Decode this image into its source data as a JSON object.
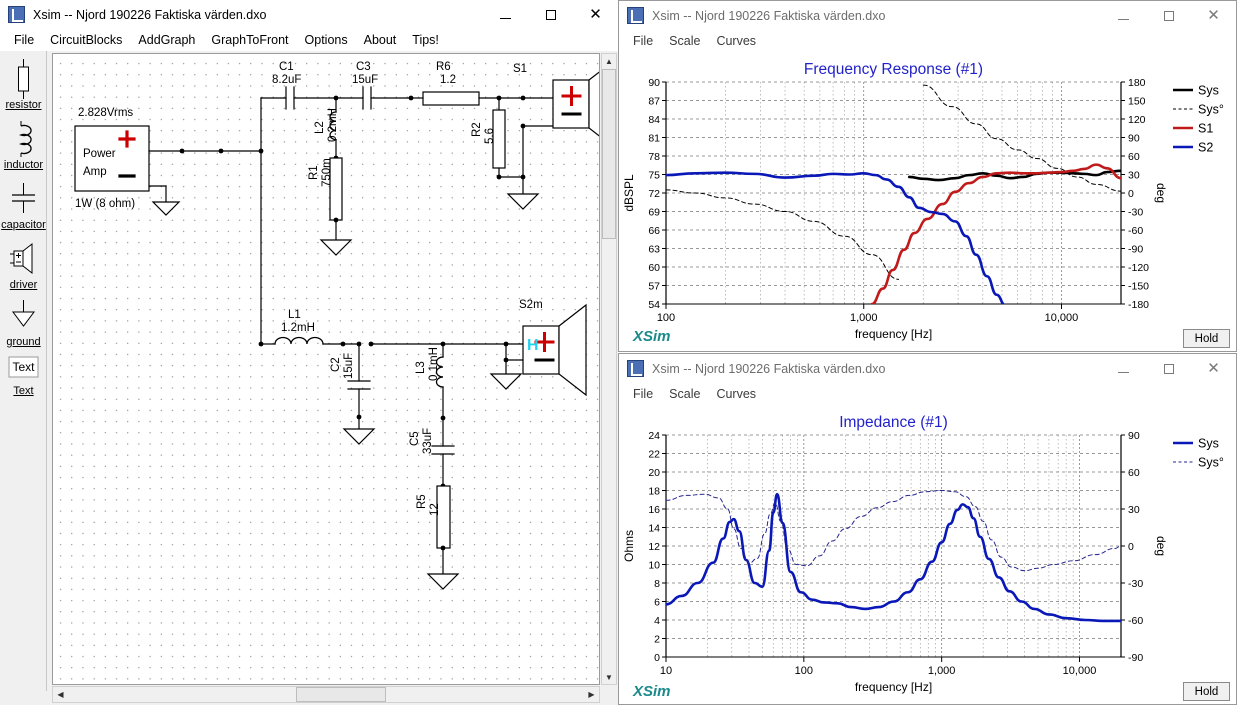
{
  "main_window": {
    "title": "Xsim -- Njord 190226 Faktiska värden.dxo",
    "icon": "xsim-app-icon",
    "controls": {
      "minimize": "—",
      "maximize": "☐",
      "close": "✕"
    },
    "menu": [
      "File",
      "CircuitBlocks",
      "AddGraph",
      "GraphToFront",
      "Options",
      "About",
      "Tips!"
    ],
    "palette": [
      {
        "label": "resistor",
        "icon": "resistor-icon"
      },
      {
        "label": "inductor",
        "icon": "inductor-icon"
      },
      {
        "label": "capacitor",
        "icon": "capacitor-icon"
      },
      {
        "label": "driver",
        "icon": "driver-icon"
      },
      {
        "label": "ground",
        "icon": "ground-icon"
      },
      {
        "label": "Text",
        "icon": "text-box-icon"
      },
      {
        "label": "Text",
        "icon": "text-label-icon"
      }
    ],
    "schematic": {
      "source": {
        "voltage": "2.828Vrms",
        "line1": "Power",
        "line2": "Amp",
        "power": "1W (8 ohm)"
      },
      "components": [
        {
          "ref": "C1",
          "value": "8.2uF"
        },
        {
          "ref": "C3",
          "value": "15uF"
        },
        {
          "ref": "R6",
          "value": "1.2"
        },
        {
          "ref": "L2",
          "value": "0.2mH"
        },
        {
          "ref": "R1",
          "value": "750m"
        },
        {
          "ref": "R2",
          "value": "5.6"
        },
        {
          "ref": "L1",
          "value": "1.2mH"
        },
        {
          "ref": "C2",
          "value": "15uF"
        },
        {
          "ref": "L3",
          "value": "0.1mH"
        },
        {
          "ref": "C5",
          "value": "33uF"
        },
        {
          "ref": "R5",
          "value": "12"
        }
      ],
      "drivers": [
        {
          "ref": "S1"
        },
        {
          "ref": "S2m",
          "marker": "H"
        }
      ]
    }
  },
  "freq_window": {
    "title": "Xsim -- Njord 190226 Faktiska värden.dxo",
    "controls": {
      "minimize": "—",
      "maximize": "☐",
      "close": "✕"
    },
    "menu": [
      "File",
      "Scale",
      "Curves"
    ],
    "hold_label": "Hold",
    "watermark": "XSim"
  },
  "imp_window": {
    "title": "Xsim -- Njord 190226 Faktiska värden.dxo",
    "controls": {
      "minimize": "—",
      "maximize": "☐",
      "close": "✕"
    },
    "menu": [
      "File",
      "Scale",
      "Curves"
    ],
    "hold_label": "Hold",
    "watermark": "XSim"
  },
  "chart_data": [
    {
      "type": "line",
      "id": "frequency-response",
      "title": "Frequency Response (#1)",
      "xlabel": "frequency [Hz]",
      "ylabel": "dBSPL",
      "y2label": "deg",
      "xscale": "log",
      "xlim": [
        100,
        20000
      ],
      "xticks": [
        100,
        1000,
        10000
      ],
      "xticklabels": [
        "100",
        "1,000",
        "10,000"
      ],
      "ylim": [
        54,
        90
      ],
      "yticks": [
        54,
        57,
        60,
        63,
        66,
        69,
        72,
        75,
        78,
        81,
        84,
        87,
        90
      ],
      "y2lim": [
        -180,
        180
      ],
      "y2ticks": [
        -180,
        -150,
        -120,
        -90,
        -60,
        -30,
        0,
        30,
        60,
        90,
        120,
        150,
        180
      ],
      "grid": true,
      "legend_position": "right",
      "legend": [
        {
          "name": "Sys",
          "color": "#000000",
          "style": "solid"
        },
        {
          "name": "Sys°",
          "color": "#000000",
          "style": "dashed"
        },
        {
          "name": "S1",
          "color": "#c01a1a",
          "style": "solid"
        },
        {
          "name": "S2",
          "color": "#0a18b8",
          "style": "solid"
        }
      ],
      "series": [
        {
          "name": "Sys",
          "color": "#000000",
          "axis": "left",
          "x": [
            1700,
            2000,
            2400,
            2900,
            3400,
            4000,
            4700,
            5500,
            6400,
            7500,
            8600,
            10000,
            11500,
            13000,
            15000,
            17000,
            20000
          ],
          "values": [
            74.6,
            74.3,
            74.1,
            74.4,
            74.9,
            75.2,
            74.8,
            74.4,
            74.6,
            75.1,
            75.3,
            75.3,
            75.2,
            75.1,
            74.9,
            75.4,
            75.6
          ]
        },
        {
          "name": "Sys°",
          "color": "#000000",
          "axis": "right",
          "style": "dashed",
          "x": [
            100,
            140,
            200,
            280,
            400,
            560,
            800,
            1100,
            1500,
            2000,
            2800,
            3700,
            4700,
            6000,
            7500,
            9500,
            12000,
            15000,
            20000
          ],
          "values": [
            5,
            0,
            -8,
            -18,
            -30,
            -46,
            -70,
            -100,
            -140,
            175,
            140,
            112,
            88,
            70,
            56,
            40,
            26,
            14,
            3
          ]
        },
        {
          "name": "S1",
          "color": "#c01a1a",
          "axis": "left",
          "x": [
            1100,
            1250,
            1400,
            1600,
            1800,
            2100,
            2500,
            2900,
            3400,
            4000,
            4700,
            5500,
            6400,
            7500,
            8600,
            10000,
            11500,
            13000,
            15000,
            17000,
            20000
          ],
          "values": [
            54.0,
            56.5,
            59.5,
            62.8,
            65.5,
            67.8,
            70.2,
            72.2,
            73.6,
            74.6,
            75.2,
            75.3,
            75.2,
            75.2,
            75.3,
            75.4,
            75.6,
            75.9,
            76.6,
            76.0,
            74.4
          ]
        },
        {
          "name": "S2",
          "color": "#0a18b8",
          "axis": "left",
          "x": [
            100,
            140,
            200,
            280,
            400,
            560,
            700,
            850,
            1000,
            1150,
            1300,
            1500,
            1700,
            1900,
            2200,
            2500,
            2900,
            3300,
            3700,
            4200,
            4700,
            5200
          ],
          "values": [
            74.9,
            75.2,
            75.3,
            75.1,
            74.5,
            74.8,
            75.1,
            75.0,
            75.2,
            74.9,
            74.2,
            73.0,
            71.3,
            69.6,
            68.9,
            68.6,
            67.4,
            65.0,
            62.0,
            58.5,
            55.5,
            53.8
          ]
        }
      ]
    },
    {
      "type": "line",
      "id": "impedance",
      "title": "Impedance (#1)",
      "xlabel": "frequency [Hz]",
      "ylabel": "Ohms",
      "y2label": "deg",
      "xscale": "log",
      "xlim": [
        10,
        20000
      ],
      "xticks": [
        10,
        100,
        1000,
        10000
      ],
      "xticklabels": [
        "10",
        "100",
        "1,000",
        "10,000"
      ],
      "ylim": [
        0,
        24
      ],
      "yticks": [
        0,
        2,
        4,
        6,
        8,
        10,
        12,
        14,
        16,
        18,
        20,
        22,
        24
      ],
      "y2lim": [
        -90,
        90
      ],
      "y2ticks": [
        -90,
        -60,
        -30,
        0,
        30,
        60,
        90
      ],
      "grid": true,
      "legend_position": "right",
      "legend": [
        {
          "name": "Sys",
          "color": "#0a18b8",
          "style": "solid"
        },
        {
          "name": "Sys°",
          "color": "#26268f",
          "style": "dashed"
        }
      ],
      "series": [
        {
          "name": "Sys",
          "color": "#0a18b8",
          "axis": "left",
          "x": [
            10,
            13,
            17,
            22,
            26,
            29,
            31,
            34,
            38,
            44,
            50,
            56,
            60,
            64,
            70,
            80,
            95,
            115,
            140,
            175,
            220,
            280,
            350,
            450,
            570,
            700,
            850,
            1000,
            1150,
            1300,
            1420,
            1550,
            1700,
            1900,
            2200,
            2600,
            3100,
            3800,
            4700,
            6000,
            8000,
            11000,
            15000,
            20000
          ],
          "values": [
            5.7,
            6.6,
            8.0,
            10.2,
            12.8,
            14.6,
            14.9,
            13.6,
            10.5,
            8.0,
            7.6,
            11.5,
            15.6,
            17.6,
            14.5,
            9.2,
            7.0,
            6.2,
            5.9,
            5.8,
            5.4,
            5.2,
            5.4,
            6.0,
            7.0,
            8.4,
            10.3,
            12.4,
            14.4,
            15.9,
            16.5,
            16.2,
            15.0,
            13.0,
            10.6,
            8.6,
            7.1,
            6.0,
            5.2,
            4.6,
            4.2,
            4.0,
            3.9,
            3.9
          ]
        },
        {
          "name": "Sys°",
          "color": "#26268f",
          "axis": "right",
          "style": "dashed",
          "x": [
            10,
            14,
            19,
            24,
            28,
            31,
            35,
            40,
            46,
            52,
            57,
            62,
            68,
            76,
            88,
            105,
            130,
            160,
            200,
            260,
            340,
            440,
            580,
            760,
            1000,
            1250,
            1500,
            1750,
            2000,
            2300,
            2700,
            3200,
            4000,
            5000,
            6500,
            9000,
            13000,
            18000,
            20000
          ],
          "values": [
            37,
            41,
            42,
            39,
            30,
            14,
            -2,
            -14,
            -10,
            10,
            26,
            35,
            20,
            -2,
            -15,
            -16,
            -8,
            4,
            14,
            24,
            31,
            36,
            41,
            44,
            45,
            44,
            40,
            32,
            20,
            5,
            -9,
            -17,
            -20,
            -18,
            -15,
            -12,
            -7,
            -2,
            0
          ]
        }
      ]
    }
  ]
}
